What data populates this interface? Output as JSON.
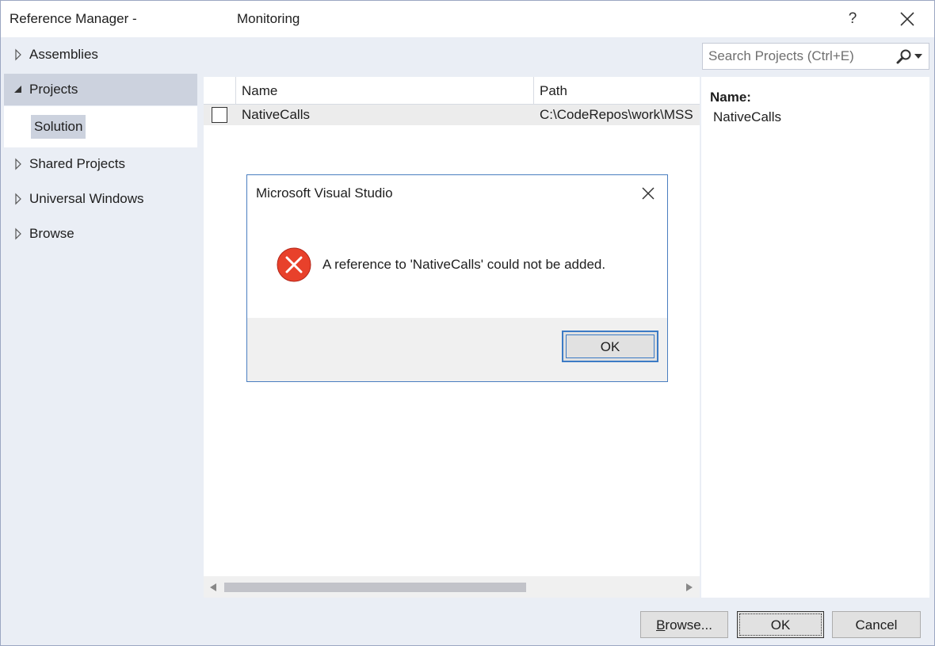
{
  "window": {
    "title": "Reference Manager -",
    "project": "Monitoring",
    "help_label": "?"
  },
  "nav": {
    "items": [
      {
        "label": "Assemblies",
        "expanded": false
      },
      {
        "label": "Projects",
        "expanded": true,
        "selected": true
      },
      {
        "label": "Shared Projects",
        "expanded": false
      },
      {
        "label": "Universal Windows",
        "expanded": false
      },
      {
        "label": "Browse",
        "expanded": false
      }
    ],
    "sub_item": "Solution"
  },
  "search": {
    "placeholder": "Search Projects (Ctrl+E)"
  },
  "table": {
    "columns": [
      "Name",
      "Path"
    ],
    "rows": [
      {
        "checked": false,
        "name": "NativeCalls",
        "path": "C:\\CodeRepos\\work\\MSS"
      }
    ]
  },
  "details": {
    "label": "Name:",
    "value": "NativeCalls"
  },
  "buttons": {
    "browse_prefix": "B",
    "browse_rest": "rowse...",
    "ok": "OK",
    "cancel": "Cancel"
  },
  "dialog": {
    "title": "Microsoft Visual Studio",
    "message": "A reference to 'NativeCalls' could not be added.",
    "ok": "OK",
    "icon": "error-icon"
  },
  "colors": {
    "error_red": "#e8412b",
    "focus_blue": "#3c7bc5",
    "selection_gray": "#ccd2de"
  }
}
